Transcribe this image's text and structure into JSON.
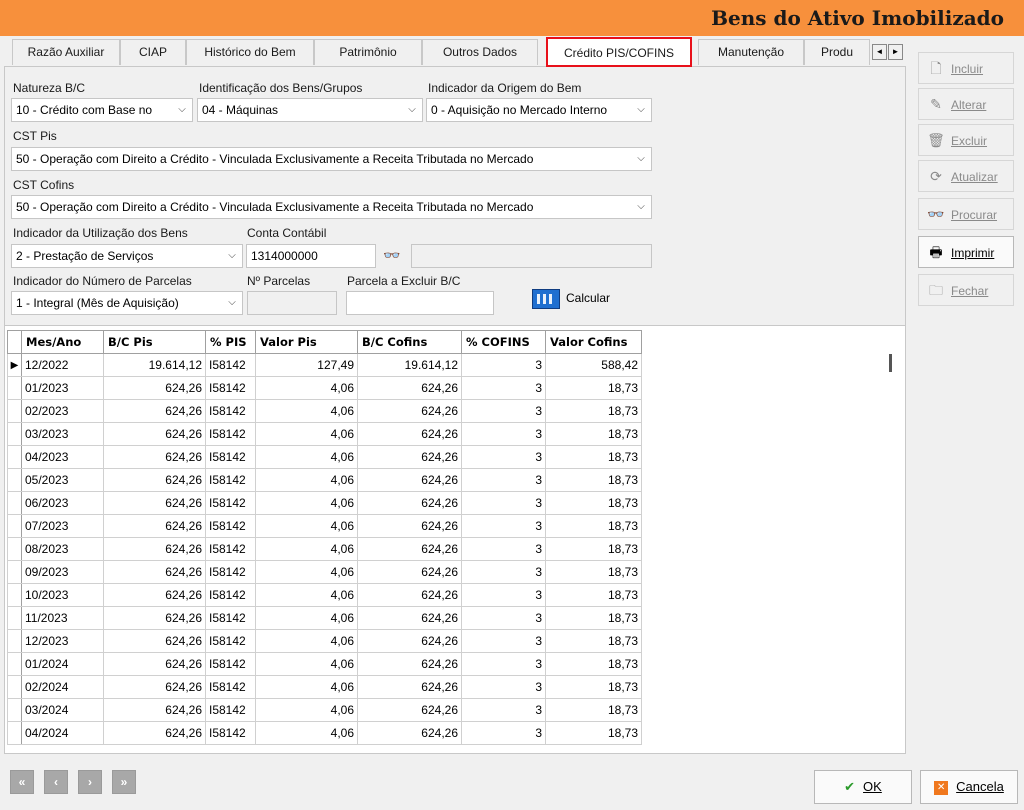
{
  "window": {
    "title": "Bens do Ativo Imobilizado"
  },
  "tabs": [
    {
      "label": "Razão Auxiliar"
    },
    {
      "label": "CIAP"
    },
    {
      "label": "Histórico do Bem"
    },
    {
      "label": "Patrimônio"
    },
    {
      "label": "Outros Dados"
    },
    {
      "label": "Crédito PIS/COFINS",
      "active": true
    },
    {
      "label": "Manutenção"
    },
    {
      "label": "Produ"
    }
  ],
  "tab_scroll": {
    "left": "◄",
    "right": "►"
  },
  "form": {
    "natureza": {
      "label": "Natureza B/C",
      "value": "10 - Crédito com Base no"
    },
    "identificacao": {
      "label": "Identificação dos Bens/Grupos",
      "value": "04 - Máquinas"
    },
    "origem": {
      "label": "Indicador da Origem do Bem",
      "value": "0 - Aquisição no Mercado Interno"
    },
    "cst_pis": {
      "label": "CST Pis",
      "value": "50 - Operação com Direito a Crédito - Vinculada Exclusivamente a Receita Tributada no Mercado"
    },
    "cst_cofins": {
      "label": "CST Cofins",
      "value": "50 - Operação com Direito a Crédito - Vinculada Exclusivamente a Receita Tributada no Mercado"
    },
    "utilizacao": {
      "label": "Indicador da Utilização dos Bens",
      "value": "2 - Prestação de Serviços"
    },
    "conta": {
      "label": "Conta Contábil",
      "value": "1314000000",
      "description": ""
    },
    "num_parcelas_ind": {
      "label": "Indicador do Número de Parcelas",
      "value": "1 - Integral (Mês de Aquisição)"
    },
    "num_parcelas": {
      "label": "Nº Parcelas",
      "value": ""
    },
    "parcela_excluir": {
      "label": "Parcela a Excluir B/C",
      "value": ""
    },
    "calcular": {
      "label": "Calcular"
    }
  },
  "grid": {
    "columns": [
      "Mes/Ano",
      "B/C Pis",
      "% PIS",
      "Valor Pis",
      "B/C Cofins",
      "% COFINS",
      "Valor Cofins"
    ],
    "rows": [
      [
        "12/2022",
        "19.614,12",
        "I58142",
        "127,49",
        "19.614,12",
        "3",
        "588,42"
      ],
      [
        "01/2023",
        "624,26",
        "I58142",
        "4,06",
        "624,26",
        "3",
        "18,73"
      ],
      [
        "02/2023",
        "624,26",
        "I58142",
        "4,06",
        "624,26",
        "3",
        "18,73"
      ],
      [
        "03/2023",
        "624,26",
        "I58142",
        "4,06",
        "624,26",
        "3",
        "18,73"
      ],
      [
        "04/2023",
        "624,26",
        "I58142",
        "4,06",
        "624,26",
        "3",
        "18,73"
      ],
      [
        "05/2023",
        "624,26",
        "I58142",
        "4,06",
        "624,26",
        "3",
        "18,73"
      ],
      [
        "06/2023",
        "624,26",
        "I58142",
        "4,06",
        "624,26",
        "3",
        "18,73"
      ],
      [
        "07/2023",
        "624,26",
        "I58142",
        "4,06",
        "624,26",
        "3",
        "18,73"
      ],
      [
        "08/2023",
        "624,26",
        "I58142",
        "4,06",
        "624,26",
        "3",
        "18,73"
      ],
      [
        "09/2023",
        "624,26",
        "I58142",
        "4,06",
        "624,26",
        "3",
        "18,73"
      ],
      [
        "10/2023",
        "624,26",
        "I58142",
        "4,06",
        "624,26",
        "3",
        "18,73"
      ],
      [
        "11/2023",
        "624,26",
        "I58142",
        "4,06",
        "624,26",
        "3",
        "18,73"
      ],
      [
        "12/2023",
        "624,26",
        "I58142",
        "4,06",
        "624,26",
        "3",
        "18,73"
      ],
      [
        "01/2024",
        "624,26",
        "I58142",
        "4,06",
        "624,26",
        "3",
        "18,73"
      ],
      [
        "02/2024",
        "624,26",
        "I58142",
        "4,06",
        "624,26",
        "3",
        "18,73"
      ],
      [
        "03/2024",
        "624,26",
        "I58142",
        "4,06",
        "624,26",
        "3",
        "18,73"
      ],
      [
        "04/2024",
        "624,26",
        "I58142",
        "4,06",
        "624,26",
        "3",
        "18,73"
      ]
    ],
    "current_row_marker": "▶"
  },
  "toolbar": {
    "incluir": {
      "label": "Incluir",
      "icon": "document-icon"
    },
    "alterar": {
      "label": "Alterar",
      "icon": "edit-icon"
    },
    "excluir": {
      "label": "Excluir",
      "icon": "delete-icon"
    },
    "atualizar": {
      "label": "Atualizar",
      "icon": "refresh-icon"
    },
    "procurar": {
      "label": "Procurar",
      "icon": "binoculars-icon"
    },
    "imprimir": {
      "label": "Imprimir",
      "icon": "printer-icon"
    },
    "fechar": {
      "label": "Fechar",
      "icon": "close-folder-icon"
    }
  },
  "navigation": {
    "first": "«",
    "prev": "‹",
    "next": "›",
    "last": "»"
  },
  "actions": {
    "ok": "OK",
    "cancel": "Cancela"
  },
  "colors": {
    "titlebar": "#f7903c",
    "active_tab_border": "#e8101a",
    "calc_icon": "#1f6fd0"
  }
}
